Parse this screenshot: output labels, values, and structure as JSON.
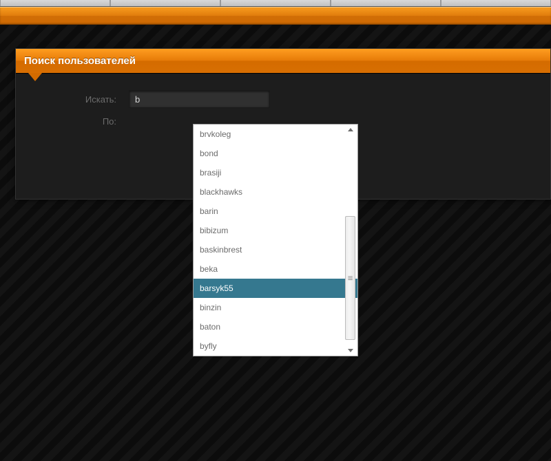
{
  "colors": {
    "accent_orange": "#e67a08",
    "highlight_teal": "#35788f",
    "panel_bg": "#1d1d1d"
  },
  "panel": {
    "title": "Поиск пользователей",
    "labels": {
      "search": "Искать:",
      "by": "По:"
    }
  },
  "search": {
    "value": "b",
    "placeholder": ""
  },
  "autocomplete": {
    "selected_index": 8,
    "items": [
      "brvkoleg",
      "bond",
      "brasiji",
      "blackhawks",
      "barin",
      "bibizum",
      "baskinbrest",
      "beka",
      "barsyk55",
      "binzin",
      "baton",
      "byfly"
    ]
  }
}
